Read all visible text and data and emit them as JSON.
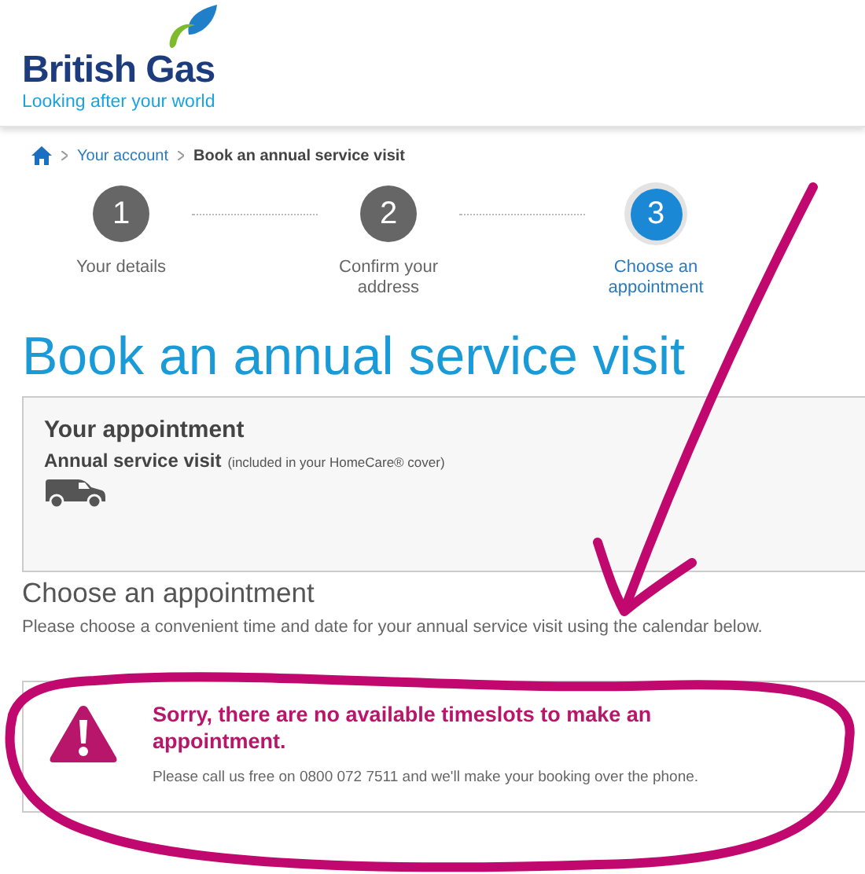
{
  "logo": {
    "name": "British Gas",
    "tagline": "Looking after your world"
  },
  "breadcrumb": {
    "items": [
      "Your account"
    ],
    "current": "Book an annual service visit"
  },
  "steps": [
    {
      "number": "1",
      "label": "Your details",
      "selected": false
    },
    {
      "number": "2",
      "label": "Confirm your address",
      "selected": false
    },
    {
      "number": "3",
      "label": "Choose an appointment",
      "selected": true
    }
  ],
  "title": "Book an annual service visit",
  "appointment": {
    "heading": "Your appointment",
    "service": "Annual service visit",
    "note": "(included in your HomeCare® cover)"
  },
  "choose": {
    "heading": "Choose an appointment",
    "text": "Please choose a convenient time and date for your annual service visit using the calendar below."
  },
  "alert": {
    "message": "Sorry, there are no available timeslots to make an appointment.",
    "detail": "Please call us free on 0800 072 7511 and we'll make your booking over the phone."
  }
}
